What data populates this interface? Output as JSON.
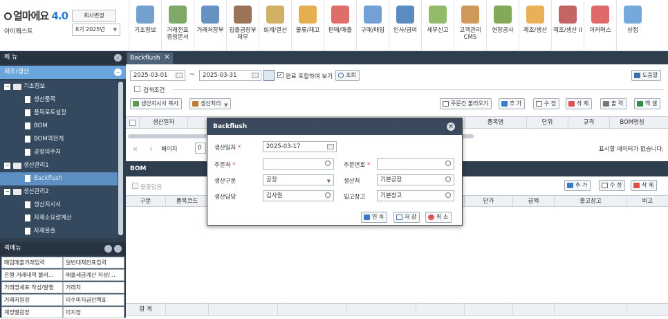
{
  "app": {
    "logo_text": "얼마에요",
    "logo_version": "4.0",
    "company_name": "아이퀘스트",
    "change_company": "회사변경",
    "fiscal_year": "8기 2025년"
  },
  "top_menu": [
    {
      "label": "기초정보",
      "icon": "basic-info-icon",
      "color": "#5b8fc7"
    },
    {
      "label": "거래전표\n증빙문서",
      "icon": "voucher-icon",
      "color": "#6a9a4e"
    },
    {
      "label": "거래처장부",
      "icon": "ledger-icon",
      "color": "#4a7fb5"
    },
    {
      "label": "입출금장부\n재무",
      "icon": "finance-icon",
      "color": "#8a5a3a"
    },
    {
      "label": "회계/결산",
      "icon": "accounting-icon",
      "color": "#c9a24a"
    },
    {
      "label": "물류/재고",
      "icon": "logistics-icon",
      "color": "#e0a030"
    },
    {
      "label": "판매/매출",
      "icon": "sales-icon",
      "color": "#d9534f"
    },
    {
      "label": "구매/매입",
      "icon": "purchase-icon",
      "color": "#5a8fd0"
    },
    {
      "label": "인사/급여",
      "icon": "hr-icon",
      "color": "#3c78b5"
    },
    {
      "label": "세무신고",
      "icon": "tax-icon",
      "color": "#7fb04f"
    },
    {
      "label": "고객관리\nCMS",
      "icon": "customer-icon",
      "color": "#c8873f"
    },
    {
      "label": "현장공사",
      "icon": "construction-icon",
      "color": "#6f9a3c"
    },
    {
      "label": "제조/생산",
      "icon": "manufacture-icon",
      "color": "#e6a23c"
    },
    {
      "label": "제조/생산 II",
      "icon": "manufacture2-icon",
      "color": "#b84a4a"
    },
    {
      "label": "이커머스",
      "icon": "ecommerce-icon",
      "color": "#d94f4f"
    },
    {
      "label": "상점",
      "icon": "shop-icon",
      "color": "#5b9bd5"
    }
  ],
  "sidebar": {
    "title": "메 뉴",
    "category": "제조/생산",
    "tree": [
      {
        "label": "기초정보",
        "level": 0,
        "type": "folder",
        "expand": "−"
      },
      {
        "label": "생산품목",
        "level": 1,
        "type": "doc"
      },
      {
        "label": "품목로트설정",
        "level": 1,
        "type": "doc"
      },
      {
        "label": "BOM",
        "level": 1,
        "type": "doc"
      },
      {
        "label": "BOM역전개",
        "level": 1,
        "type": "doc"
      },
      {
        "label": "공정의주처",
        "level": 1,
        "type": "doc"
      },
      {
        "label": "생산관리1",
        "level": 0,
        "type": "folder",
        "expand": "−"
      },
      {
        "label": "Backflush",
        "level": 1,
        "type": "doc",
        "selected": true
      },
      {
        "label": "생산관리2",
        "level": 0,
        "type": "folder",
        "expand": "−"
      },
      {
        "label": "생산지시서",
        "level": 1,
        "type": "doc"
      },
      {
        "label": "자재소요량계산",
        "level": 1,
        "type": "doc"
      },
      {
        "label": "자재불출",
        "level": 1,
        "type": "doc"
      },
      {
        "label": "생산관리",
        "level": 1,
        "type": "doc"
      }
    ],
    "quick_menu_title": "퀵메뉴",
    "quick_menu": [
      [
        "매입매출거래입력",
        "일반대체전표입력"
      ],
      [
        "은행 거래내역 불러...",
        "매출세금계산 작성/..."
      ],
      [
        "거래명세표 작성/발행",
        "거래처"
      ],
      [
        "거래처원장",
        "미수미지급잔액표"
      ],
      [
        "계정별원장",
        "미지정"
      ]
    ]
  },
  "tab": {
    "label": "Backflush",
    "close": "×"
  },
  "filter": {
    "date_from": "2025-03-01",
    "tilde": "~",
    "date_to": "2025-03-31",
    "include_done": "완료 포함하여 보기",
    "search_btn": "조회",
    "help_btn": "도움말",
    "search_cond": "검색조건"
  },
  "toolbar": {
    "copy_order": "생산지시서 복사",
    "process": "생산처리",
    "load_order": "주문건 불러오기",
    "add": "추 가",
    "edit": "수 정",
    "delete": "삭 제",
    "print": "출 력",
    "excel": "엑 셀"
  },
  "grid": {
    "headers": [
      "생산일자",
      "",
      "",
      "",
      "",
      "품목명",
      "단위",
      "규격",
      "BOM명칭"
    ],
    "page_label": "페이지",
    "page_value": "0",
    "no_data": "표시할 데이터가 없습니다."
  },
  "bom": {
    "title": "BOM",
    "checkbox": "불출없음",
    "add": "추 가",
    "edit": "수 정",
    "delete": "삭 제",
    "headers": [
      "구분",
      "품목코드",
      "",
      "",
      "",
      "",
      "단가",
      "금액",
      "출고창고",
      "비고"
    ],
    "total": "합 계"
  },
  "modal": {
    "title": "Backflush",
    "fields": {
      "prod_date_label": "생산일자",
      "prod_date": "2025-03-17",
      "customer_label": "주문처",
      "customer": "",
      "order_no_label": "주문번호",
      "order_no": "",
      "type_label": "생산구분",
      "type": "공장",
      "place_label": "생산처",
      "place": "기본공장",
      "manager_label": "생산담당",
      "manager": "김사원",
      "warehouse_label": "입고창고",
      "warehouse": "기본창고"
    },
    "buttons": {
      "continue": "연 속",
      "save": "저 장",
      "cancel": "취 소"
    }
  }
}
